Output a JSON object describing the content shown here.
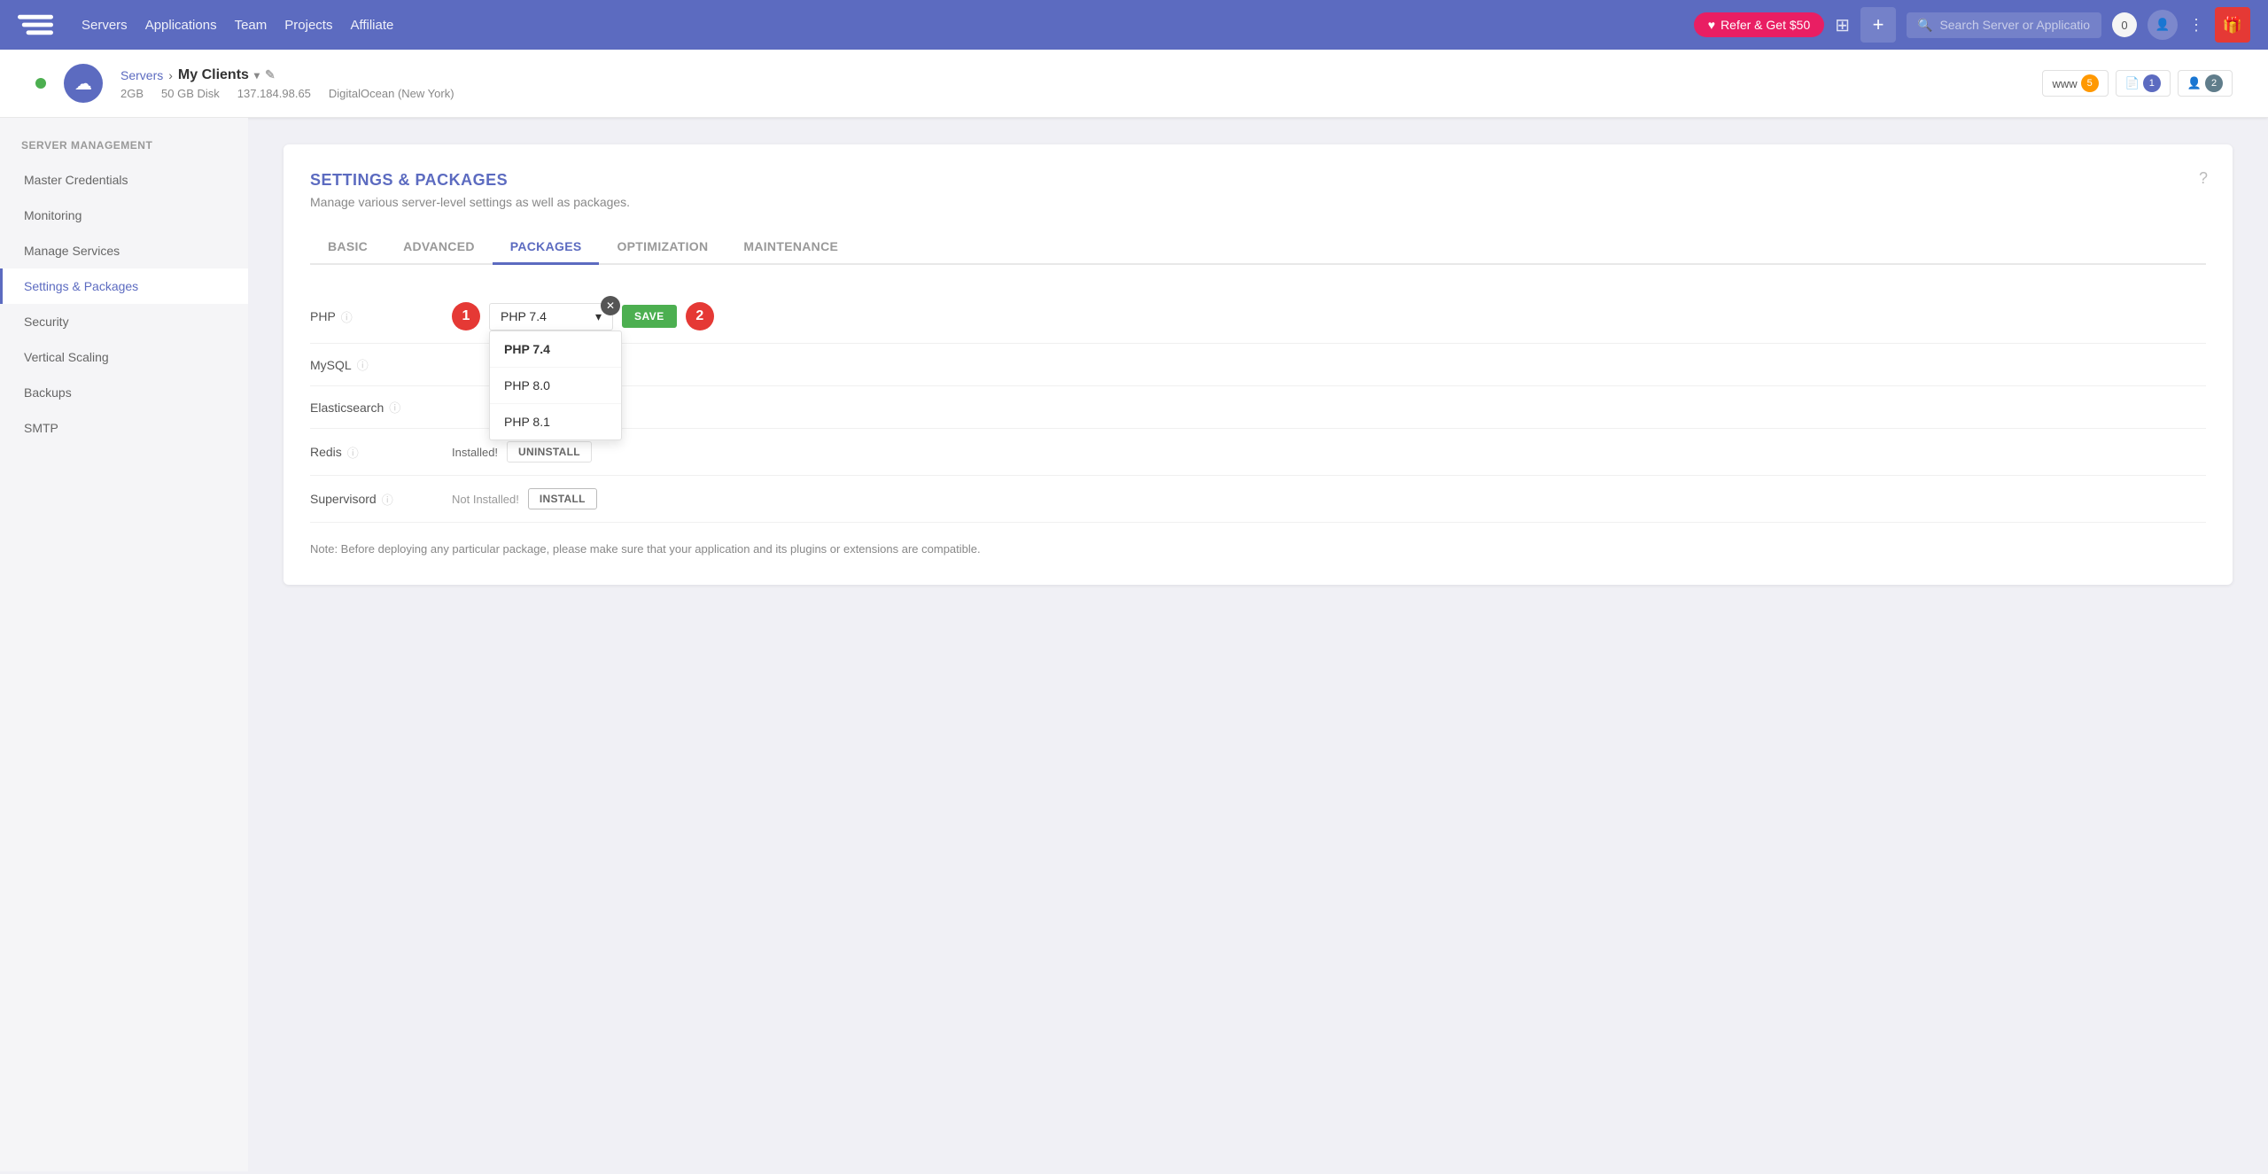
{
  "nav": {
    "links": [
      "Servers",
      "Applications",
      "Team",
      "Projects",
      "Affiliate"
    ],
    "refer_label": "Refer & Get $50",
    "search_placeholder": "Search Server or Application",
    "notification_count": "0"
  },
  "server": {
    "breadcrumb_servers": "Servers",
    "server_name": "My Clients",
    "ram": "2GB",
    "disk": "50 GB Disk",
    "ip": "137.184.98.65",
    "provider": "DigitalOcean (New York)",
    "badges": [
      {
        "icon": "www",
        "count": "5",
        "color": "orange"
      },
      {
        "icon": "file",
        "count": "1",
        "color": "blue"
      },
      {
        "icon": "user",
        "count": "2",
        "color": "gray"
      }
    ]
  },
  "sidebar": {
    "section_title": "Server Management",
    "items": [
      {
        "label": "Master Credentials",
        "active": false
      },
      {
        "label": "Monitoring",
        "active": false
      },
      {
        "label": "Manage Services",
        "active": false
      },
      {
        "label": "Settings & Packages",
        "active": true
      },
      {
        "label": "Security",
        "active": false
      },
      {
        "label": "Vertical Scaling",
        "active": false
      },
      {
        "label": "Backups",
        "active": false
      },
      {
        "label": "SMTP",
        "active": false
      }
    ]
  },
  "content": {
    "title": "SETTINGS & PACKAGES",
    "subtitle": "Manage various server-level settings as well as packages.",
    "tabs": [
      {
        "label": "BASIC",
        "active": false
      },
      {
        "label": "ADVANCED",
        "active": false
      },
      {
        "label": "PACKAGES",
        "active": true
      },
      {
        "label": "OPTIMIZATION",
        "active": false
      },
      {
        "label": "MAINTENANCE",
        "active": false
      }
    ],
    "packages": [
      {
        "name": "PHP",
        "has_dropdown": true,
        "dropdown_selected": "PHP 7.4",
        "dropdown_options": [
          "PHP 7.4",
          "PHP 8.0",
          "PHP 8.1"
        ],
        "step_1": "1",
        "step_2": "2",
        "save_label": "SAVE"
      },
      {
        "name": "MySQL",
        "has_dropdown": true,
        "dropdown_selected": "",
        "status": ""
      },
      {
        "name": "Elasticsearch",
        "has_dropdown": true,
        "dropdown_selected": "",
        "status": ""
      },
      {
        "name": "Redis",
        "status_text": "Installed!",
        "btn_label": "UNINSTALL",
        "installed": true
      },
      {
        "name": "Supervisord",
        "status_text": "Not Installed!",
        "btn_label": "INSTALL",
        "installed": false
      }
    ],
    "note": "Note: Before deploying any particular package, please make sure that your application and its plugins or extensions are compatible."
  }
}
